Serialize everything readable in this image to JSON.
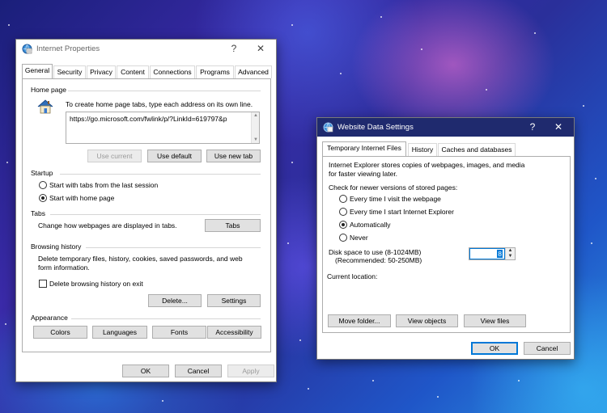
{
  "internet_properties": {
    "title": "Internet Properties",
    "help_glyph": "?",
    "close_glyph": "✕",
    "tabs": [
      "General",
      "Security",
      "Privacy",
      "Content",
      "Connections",
      "Programs",
      "Advanced"
    ],
    "home_page": {
      "group_label": "Home page",
      "instruction": "To create home page tabs, type each address on its own line.",
      "url": "https://go.microsoft.com/fwlink/p/?LinkId=619797&p",
      "use_current": "Use current",
      "use_default": "Use default",
      "use_new_tab": "Use new tab"
    },
    "startup": {
      "group_label": "Startup",
      "option_last_session": "Start with tabs from the last session",
      "option_home_page": "Start with home page"
    },
    "tabs_section": {
      "group_label": "Tabs",
      "description": "Change how webpages are displayed in tabs.",
      "button": "Tabs"
    },
    "browsing_history": {
      "group_label": "Browsing history",
      "description_line1": "Delete temporary files, history, cookies, saved passwords, and web",
      "description_line2": "form information.",
      "delete_on_exit": "Delete browsing history on exit",
      "delete_button": "Delete...",
      "settings_button": "Settings"
    },
    "appearance": {
      "group_label": "Appearance",
      "colors": "Colors",
      "languages": "Languages",
      "fonts": "Fonts",
      "accessibility": "Accessibility"
    },
    "footer": {
      "ok": "OK",
      "cancel": "Cancel",
      "apply": "Apply"
    }
  },
  "website_data_settings": {
    "title": "Website Data Settings",
    "help_glyph": "?",
    "close_glyph": "✕",
    "tabs": [
      "Temporary Internet Files",
      "History",
      "Caches and databases"
    ],
    "description_line1": "Internet Explorer stores copies of webpages, images, and media",
    "description_line2": "for faster viewing later.",
    "check_label": "Check for newer versions of stored pages:",
    "options": [
      "Every time I visit the webpage",
      "Every time I start Internet Explorer",
      "Automatically",
      "Never"
    ],
    "disk_space_line1": "Disk space to use (8-1024MB)",
    "disk_space_line2": "(Recommended: 50-250MB)",
    "disk_space_value": "8",
    "current_location": "Current location:",
    "move_folder": "Move folder...",
    "view_objects": "View objects",
    "view_files": "View files",
    "footer": {
      "ok": "OK",
      "cancel": "Cancel"
    }
  },
  "colors": {
    "accent": "#0078d7",
    "title_bar_inactive": "#ffffff",
    "title_bar_active": "#1f2a6e"
  }
}
